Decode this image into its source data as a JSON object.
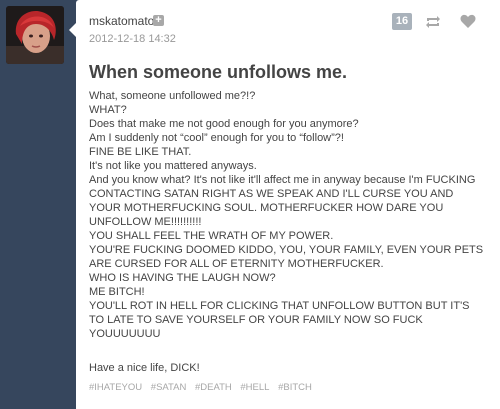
{
  "post": {
    "username": "mskatomato",
    "timestamp": "2012-12-18 14:32",
    "note_count": "16",
    "title": "When someone unfollows me.",
    "lines": [
      "What, someone unfollowed me?!?",
      "WHAT?",
      "Does that make me not good enough for you anymore?",
      "Am I suddenly not “cool” enough for you to “follow”?!",
      "FINE BE LIKE THAT.",
      "It's not like you mattered anyways.",
      "And you know what? It's not like it'll affect me in anyway because I'm FUCKING CONTACTING SATAN RIGHT AS WE SPEAK AND I'LL CURSE YOU AND YOUR MOTHERFUCKING SOUL. MOTHERFUCKER HOW DARE YOU UNFOLLOW ME!!!!!!!!!!",
      "YOU SHALL FEEL THE WRATH OF MY POWER.",
      "YOU'RE FUCKING DOOMED KIDDO, YOU, YOUR FAMILY, EVEN YOUR PETS ARE CURSED FOR ALL OF ETERNITY MOTHERFUCKER.",
      "WHO IS HAVING THE LAUGH NOW?",
      "ME BITCH!",
      "YOU'LL ROT IN HELL FOR CLICKING THAT UNFOLLOW BUTTON BUT IT'S TO LATE TO SAVE YOURSELF OR YOUR FAMILY NOW SO FUCK YOUUUUUUU"
    ],
    "signoff": "Have a nice life, DICK!",
    "tags": [
      "#IHATEYOU",
      "#SATAN",
      "#DEATH",
      "#HELL",
      "#BITCH"
    ]
  },
  "colors": {
    "dashboard_bg": "#36465d",
    "note_badge": "#a9b2bb",
    "icon_gray": "#a8a8a8"
  },
  "icons": {
    "avatar": "avatar-image",
    "follow": "plus-icon",
    "reblog": "reblog-icon",
    "like": "heart-icon"
  }
}
